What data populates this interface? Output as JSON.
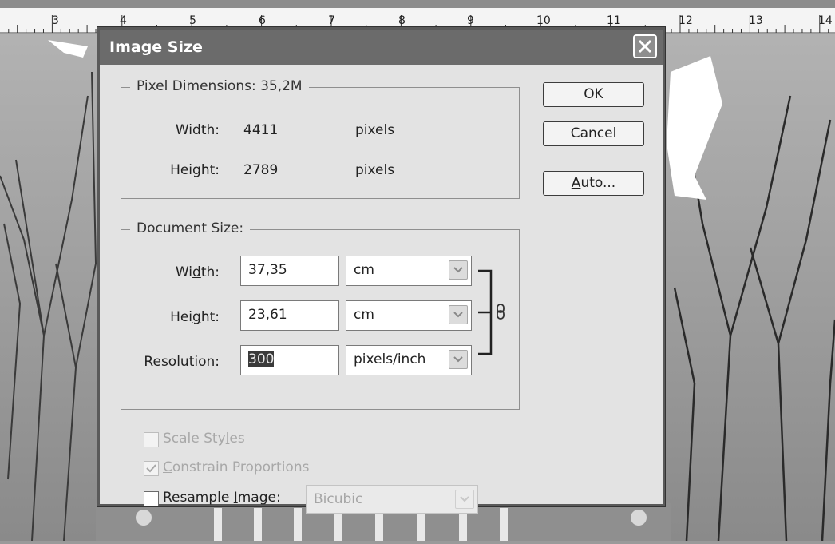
{
  "ruler": {
    "numbers": [
      "3",
      "4",
      "5",
      "6",
      "7",
      "8",
      "9",
      "10",
      "11",
      "12",
      "13",
      "14"
    ]
  },
  "dialog": {
    "title": "Image Size",
    "pixel_dimensions": {
      "legend": "Pixel Dimensions:  35,2M",
      "width_label": "Width:",
      "width_value": "4411",
      "width_unit": "pixels",
      "height_label": "Height:",
      "height_value": "2789",
      "height_unit": "pixels"
    },
    "document_size": {
      "legend": "Document Size:",
      "width_label": "Width:",
      "width_value": "37,35",
      "width_unit": "cm",
      "height_label": "Height:",
      "height_value": "23,61",
      "height_unit": "cm",
      "resolution_label": "Resolution:",
      "resolution_value": "300",
      "resolution_unit": "pixels/inch"
    },
    "buttons": {
      "ok": "OK",
      "cancel": "Cancel",
      "auto": "Auto..."
    },
    "options": {
      "scale_styles": "Scale Styles",
      "constrain": "Constrain Proportions",
      "resample": "Resample Image:",
      "resample_method": "Bicubic"
    }
  }
}
